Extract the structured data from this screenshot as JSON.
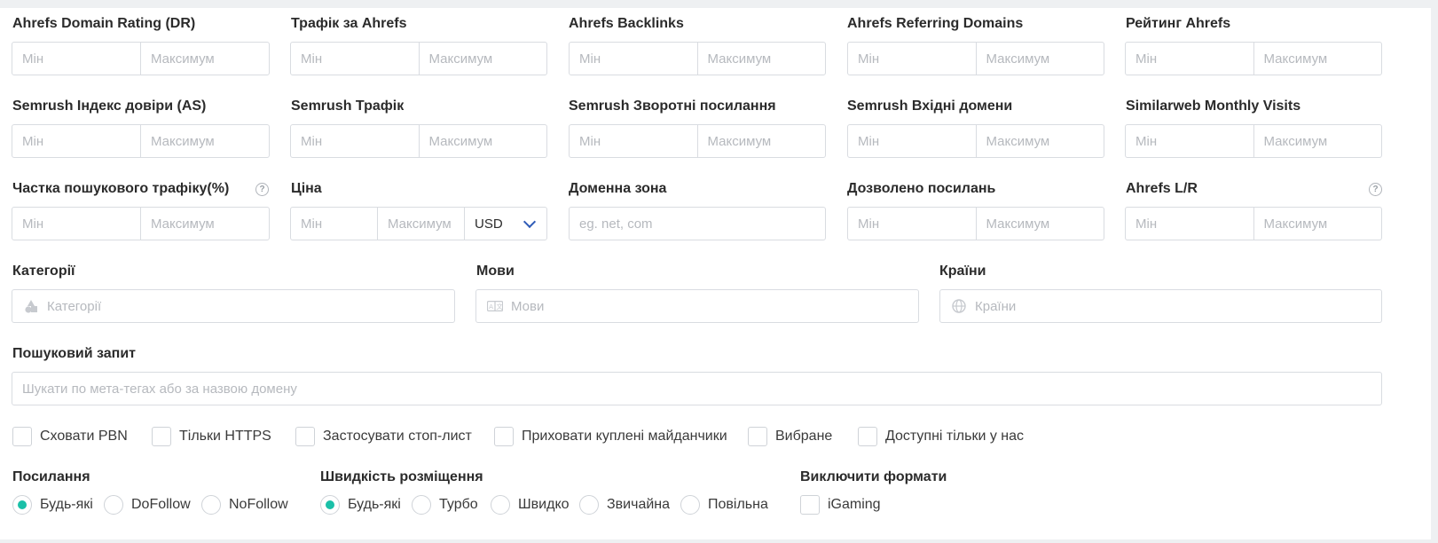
{
  "placeholders": {
    "min": "Мін",
    "max": "Максимум"
  },
  "row1": [
    {
      "label": "Ahrefs Domain Rating (DR)"
    },
    {
      "label": "Трафік за Ahrefs"
    },
    {
      "label": "Ahrefs Backlinks"
    },
    {
      "label": "Ahrefs Referring Domains"
    },
    {
      "label": "Рейтинг Ahrefs"
    }
  ],
  "row2": [
    {
      "label": "Semrush Індекс довіри (AS)"
    },
    {
      "label": "Semrush Трафік"
    },
    {
      "label": "Semrush Зворотні посилання"
    },
    {
      "label": "Semrush Вхідні домени"
    },
    {
      "label": "Similarweb Monthly Visits"
    }
  ],
  "row3": {
    "search_share": {
      "label": "Частка пошукового трафіку(%)",
      "help_icon": "question-circle-icon"
    },
    "price": {
      "label": "Ціна",
      "max_placeholder": "Максимум",
      "currency": "USD"
    },
    "domain_zone": {
      "label": "Доменна зона",
      "placeholder": "eg. net, com"
    },
    "links_allowed": {
      "label": "Дозволено посилань"
    },
    "ahrefs_lr": {
      "label": "Ahrefs L/R",
      "help_icon": "question-circle-icon"
    }
  },
  "categories": {
    "label": "Категорії",
    "placeholder": "Категорії",
    "icon": "shapes-icon"
  },
  "languages": {
    "label": "Мови",
    "placeholder": "Мови",
    "icon": "translate-icon"
  },
  "countries": {
    "label": "Країни",
    "placeholder": "Країни",
    "icon": "globe-icon"
  },
  "search": {
    "label": "Пошуковий запит",
    "placeholder": "Шукати по мета-тегах або за назвою домену"
  },
  "checkboxes": [
    {
      "label": "Сховати PBN",
      "checked": false
    },
    {
      "label": "Тільки HTTPS",
      "checked": false
    },
    {
      "label": "Застосувати стоп-лист",
      "checked": false
    },
    {
      "label": "Приховати куплені майданчики",
      "checked": false
    },
    {
      "label": "Вибране",
      "checked": false
    },
    {
      "label": "Доступні тільки у нас",
      "checked": false
    }
  ],
  "links": {
    "label": "Посилання",
    "options": [
      "Будь-які",
      "DoFollow",
      "NoFollow"
    ],
    "selected": "Будь-які"
  },
  "speed": {
    "label": "Швидкість розміщення",
    "options": [
      "Будь-які",
      "Турбо",
      "Швидко",
      "Звичайна",
      "Повільна"
    ],
    "selected": "Будь-які"
  },
  "exclude": {
    "label": "Виключити формати",
    "options": [
      "iGaming"
    ]
  },
  "colors": {
    "accent": "#1ac0a8",
    "chevron": "#2f5bb7",
    "border": "#d9dce1",
    "placeholder": "#b6b9be"
  }
}
